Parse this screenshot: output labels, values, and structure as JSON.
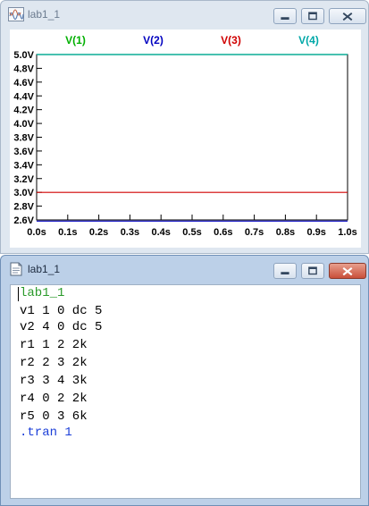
{
  "plot_window": {
    "title": "lab1_1",
    "controls": {
      "minimize": "minimize",
      "maximize": "maximize",
      "close": "close"
    }
  },
  "netlist_window": {
    "title": "lab1_1",
    "controls": {
      "minimize": "minimize",
      "maximize": "maximize",
      "close": "close"
    }
  },
  "chart_data": {
    "type": "line",
    "title": "",
    "xlabel": "",
    "ylabel": "",
    "x_ticks": [
      "0.0s",
      "0.1s",
      "0.2s",
      "0.3s",
      "0.4s",
      "0.5s",
      "0.6s",
      "0.7s",
      "0.8s",
      "0.9s",
      "1.0s"
    ],
    "y_ticks": [
      "2.6V",
      "2.8V",
      "3.0V",
      "3.2V",
      "3.4V",
      "3.6V",
      "3.8V",
      "4.0V",
      "4.2V",
      "4.4V",
      "4.6V",
      "4.8V",
      "5.0V"
    ],
    "xlim": [
      0,
      1.0
    ],
    "ylim": [
      2.6,
      5.0
    ],
    "series": [
      {
        "name": "V(1)",
        "color": "#00b000",
        "x": [
          0.0,
          1.0
        ],
        "y": [
          5.0,
          5.0
        ]
      },
      {
        "name": "V(2)",
        "color": "#0000c0",
        "x": [
          0.0,
          1.0
        ],
        "y": [
          2.583,
          2.583
        ]
      },
      {
        "name": "V(3)",
        "color": "#d00000",
        "x": [
          0.0,
          1.0
        ],
        "y": [
          3.0,
          3.0
        ]
      },
      {
        "name": "V(4)",
        "color": "#00a8a8",
        "x": [
          0.0,
          1.0
        ],
        "y": [
          5.0,
          5.0
        ]
      }
    ]
  },
  "netlist": {
    "lines": [
      {
        "text": "lab1_1",
        "color": "#2a9a2a"
      },
      {
        "text": "v1 1 0 dc 5",
        "color": "#000000"
      },
      {
        "text": "v2 4 0 dc 5",
        "color": "#000000"
      },
      {
        "text": "r1 1 2 2k",
        "color": "#000000"
      },
      {
        "text": "r2 2 3 2k",
        "color": "#000000"
      },
      {
        "text": "r3 3 4 3k",
        "color": "#000000"
      },
      {
        "text": "r4 0 2 2k",
        "color": "#000000"
      },
      {
        "text": "r5 0 3 6k",
        "color": "#000000"
      },
      {
        "text": ".tran 1",
        "color": "#1c3fd8"
      }
    ]
  }
}
